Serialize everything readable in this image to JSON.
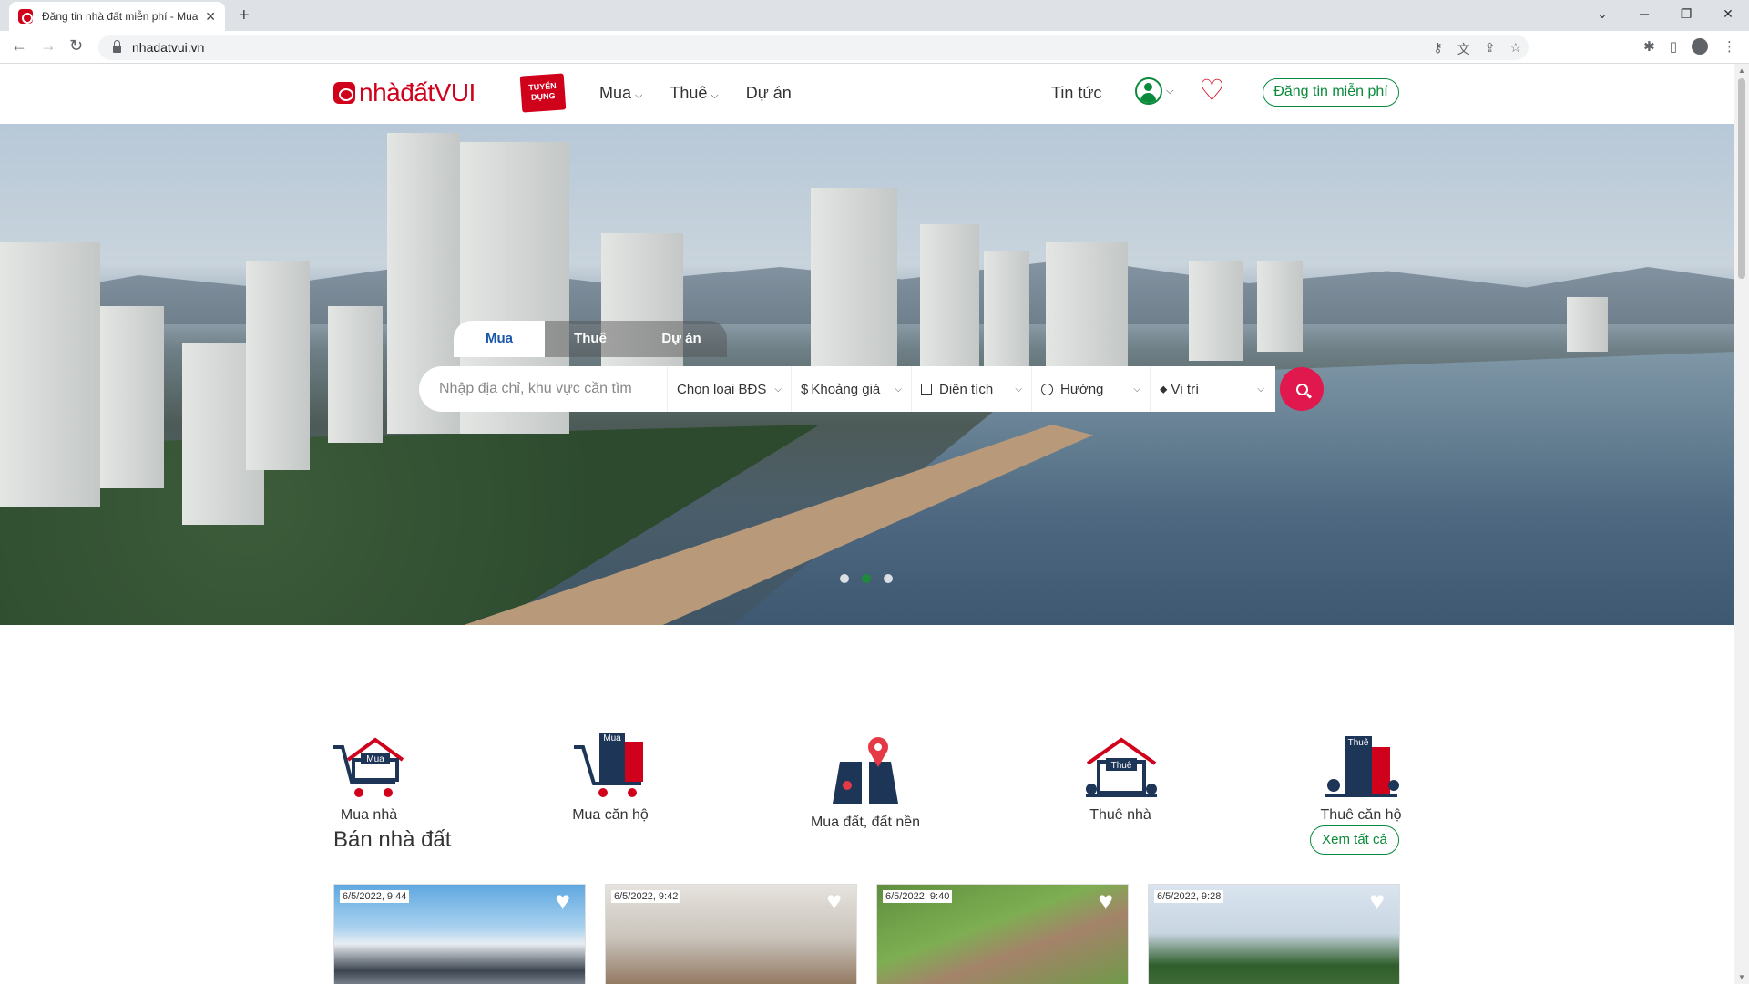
{
  "browser": {
    "tab_title": "Đăng tin nhà đất miễn phí - Mua",
    "url": "nhadatvui.vn",
    "new_tab": "+",
    "tab_close": "✕"
  },
  "header": {
    "logo_text": "nhàđấtVUI",
    "recruit_badge": "TUYỂN DỤNG",
    "menu": [
      {
        "label": "Mua"
      },
      {
        "label": "Thuê"
      },
      {
        "label": "Dự án"
      }
    ],
    "news": "Tin tức",
    "post_button": "Đăng tin miễn phí"
  },
  "search": {
    "tabs": [
      "Mua",
      "Thuê",
      "Dự án"
    ],
    "placeholder": "Nhập địa chỉ, khu vực cần tìm",
    "property_type": "Chọn loại BĐS",
    "price": "Khoảng giá",
    "area": "Diện tích",
    "direction": "Hướng",
    "location": "Vị trí",
    "price_icon": "$"
  },
  "carousel": {
    "active_index": 1,
    "count": 3
  },
  "categories": [
    {
      "label": "Mua nhà",
      "badge": "Mua"
    },
    {
      "label": "Mua căn hộ",
      "badge": "Mua"
    },
    {
      "label": "Mua đất, đất nền"
    },
    {
      "label": "Thuê nhà",
      "badge": "Thuê"
    },
    {
      "label": "Thuê căn hộ",
      "badge": "Thuê"
    }
  ],
  "listings": {
    "title": "Bán nhà đất",
    "see_all": "Xem tất cả",
    "cards": [
      {
        "timestamp": "6/5/2022, 9:44"
      },
      {
        "timestamp": "6/5/2022, 9:42"
      },
      {
        "timestamp": "6/5/2022, 9:40"
      },
      {
        "timestamp": "6/5/2022, 9:28"
      }
    ]
  },
  "colors": {
    "brand_red": "#d0021b",
    "green": "#0a8a3a",
    "search_button": "#e0184d",
    "navy": "#1d3557"
  }
}
